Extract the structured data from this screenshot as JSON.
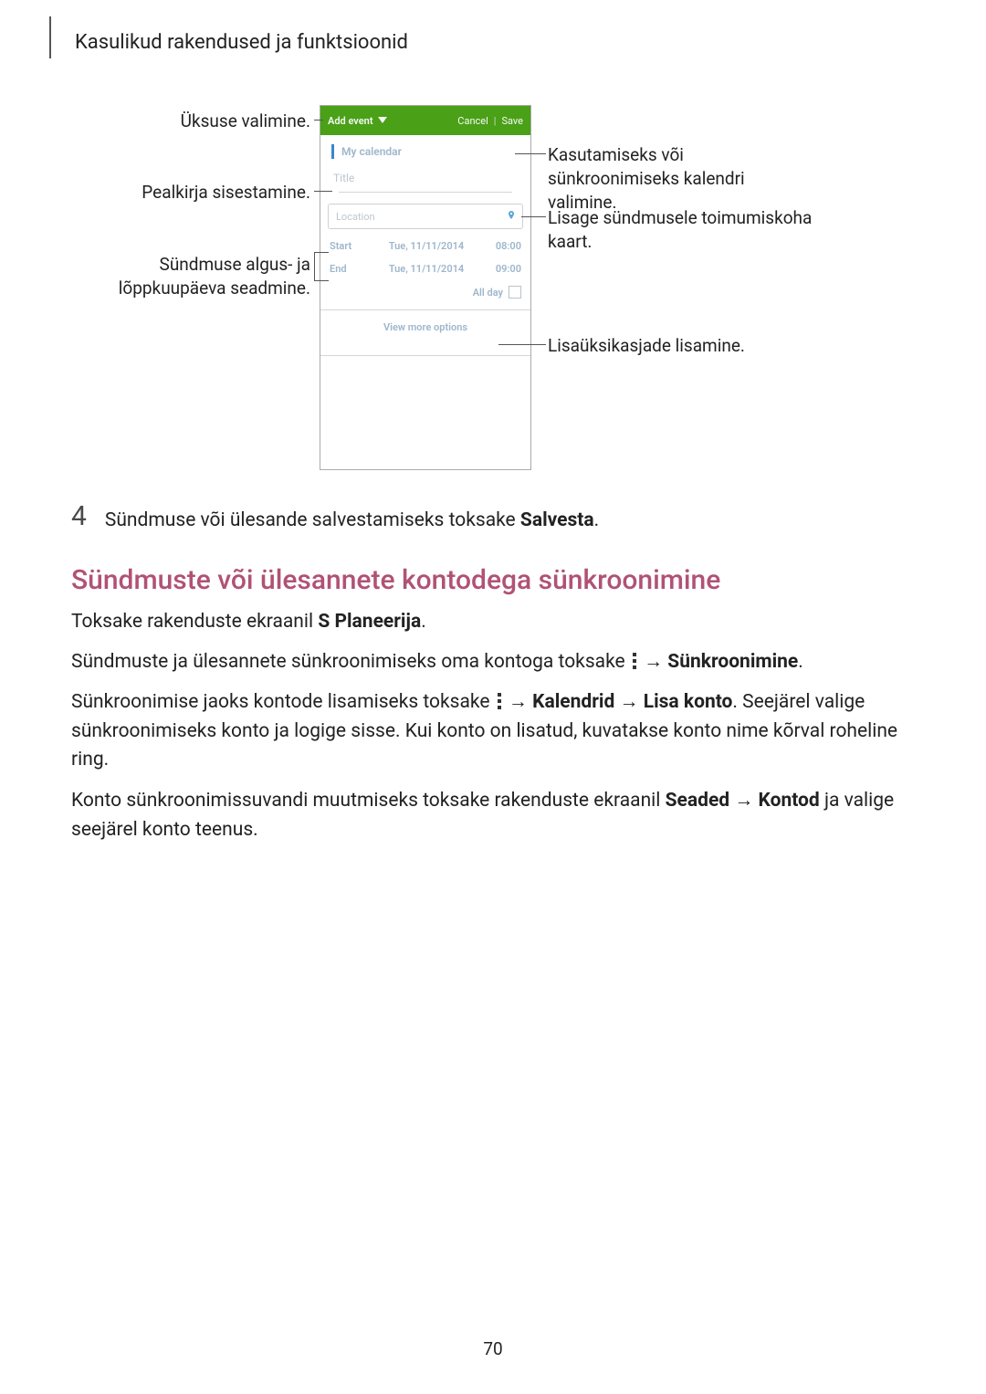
{
  "header": {
    "title": "Kasulikud rakendused ja funktsioonid"
  },
  "phone": {
    "actionbar": {
      "dropdown": "Add event",
      "cancel": "Cancel",
      "save": "Save"
    },
    "calendar_label": "My calendar",
    "title_placeholder": "Title",
    "location_placeholder": "Location",
    "start": {
      "label": "Start",
      "date": "Tue, 11/11/2014",
      "time": "08:00"
    },
    "end": {
      "label": "End",
      "date": "Tue, 11/11/2014",
      "time": "09:00"
    },
    "allday_label": "All day",
    "view_more": "View more options"
  },
  "callouts": {
    "left1": "Üksuse valimine.",
    "left2": "Pealkirja sisestamine.",
    "left3a": "Sündmuse algus- ja",
    "left3b": "lõppkuupäeva seadmine.",
    "right1a": "Kasutamiseks või",
    "right1b": "sünkroonimiseks kalendri",
    "right1c": "valimine.",
    "right2a": "Lisage sündmusele toimumiskoha",
    "right2b": "kaart.",
    "right3": "Lisaüksikasjade lisamine."
  },
  "step4": {
    "num": "4",
    "text_pre": "Sündmuse või ülesande salvestamiseks toksake ",
    "text_bold": "Salvesta",
    "text_post": "."
  },
  "h2": "Sündmuste või ülesannete kontodega sünkroonimine",
  "p1_pre": "Toksake rakenduste ekraanil ",
  "p1_bold": "S Planeerija",
  "p1_post": ".",
  "p2_pre": "Sündmuste ja ülesannete sünkroonimiseks oma kontoga toksake ",
  "p2_arrow": " → ",
  "p2_bold": "Sünkroonimine",
  "p2_post": ".",
  "p3_pre": "Sünkroonimise jaoks kontode lisamiseks toksake ",
  "p3_arrow1": " → ",
  "p3_b1": "Kalendrid",
  "p3_arrow2": " → ",
  "p3_b2": "Lisa konto",
  "p3_post1": ". Seejärel valige sünkroonimiseks konto ja logige sisse. Kui konto on lisatud, kuvatakse konto nime kõrval roheline ring.",
  "p4_pre": "Konto sünkroonimissuvandi muutmiseks toksake rakenduste ekraanil ",
  "p4_b1": "Seaded",
  "p4_arrow": " → ",
  "p4_b2": "Kontod",
  "p4_post": " ja valige seejärel konto teenus.",
  "page_number": "70"
}
